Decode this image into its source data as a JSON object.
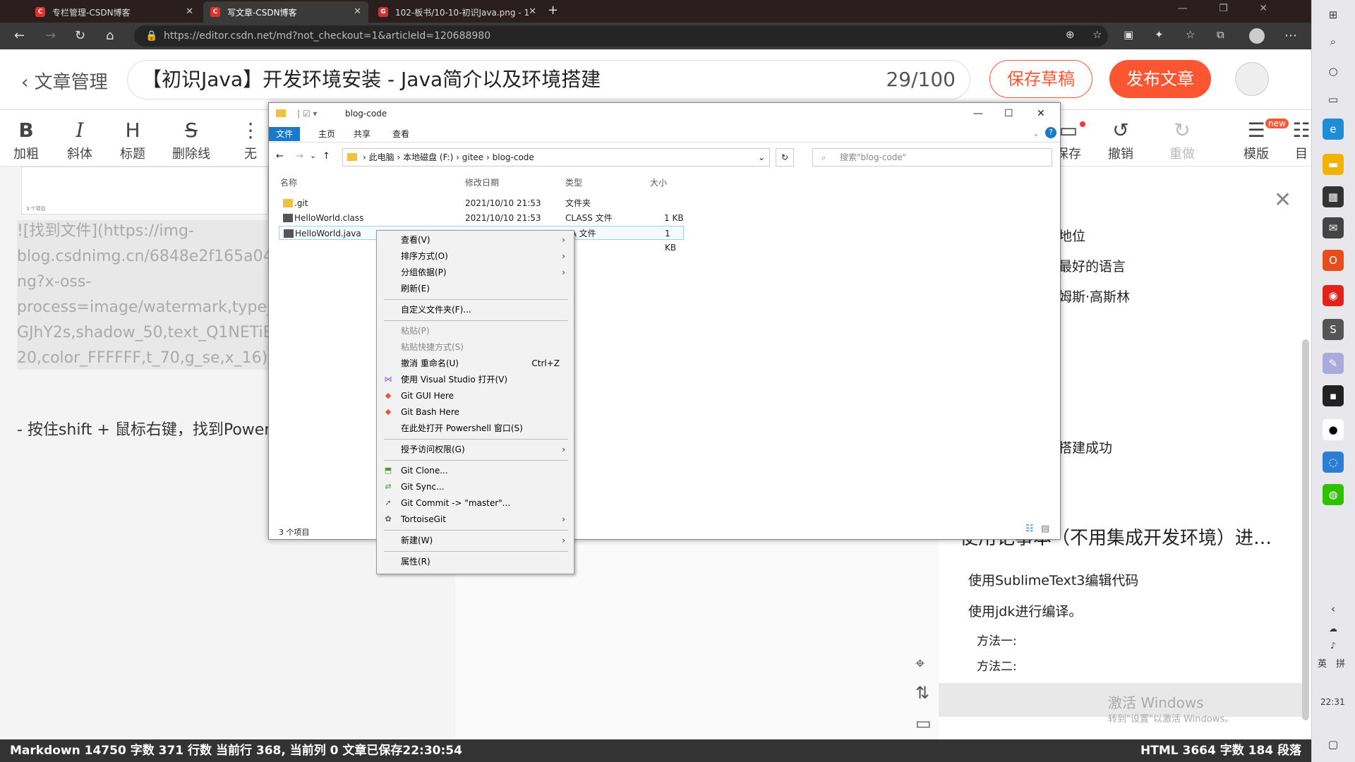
{
  "browser": {
    "tabs": [
      {
        "title": "专栏管理-CSDN博客"
      },
      {
        "title": "写文章-CSDN博客"
      },
      {
        "title": "102-板书/10-10-初识Java.png - 1"
      }
    ],
    "url": "https://editor.csdn.net/md?not_checkout=1&articleId=120688980"
  },
  "header": {
    "back_label": "文章管理",
    "title": "【初识Java】开发环境安装 - Java简介以及环境搭建",
    "title_count": "29/100",
    "save_label": "保存草稿",
    "publish_label": "发布文章"
  },
  "toolbar": {
    "left": [
      {
        "icon": "B",
        "label": "加粗"
      },
      {
        "icon": "I",
        "label": "斜体"
      },
      {
        "icon": "H",
        "label": "标题"
      },
      {
        "icon": "S",
        "label": "删除线"
      }
    ],
    "partial_label": "无",
    "right": [
      {
        "label": "保存"
      },
      {
        "label": "撤销"
      },
      {
        "label": "重做"
      },
      {
        "label": "模版"
      },
      {
        "label": "目"
      }
    ],
    "new_badge": "new"
  },
  "editor": {
    "image_caption": "3 个项目",
    "md_lines": [
      "![找到文件](https://img-",
      "blog.csdnimg.cn/6848e2f165a04d87",
      "ng?x-oss-",
      "process=image/watermark,type_ZH",
      "GJhY2s,shadow_50,text_Q1NETiBA",
      "20,color_FFFFFF,t_70,g_se,x_16)"
    ],
    "bullet_line": "- 按住shift + 鼠标右键，找到Powers"
  },
  "preview": {
    "lines": [
      "地位",
      "最好的语言",
      "姆斯·高斯林",
      "搭建成功"
    ],
    "heading": "使用记事本（不用集成开发环境）进…",
    "para1": "使用SublimeText3编辑代码",
    "para2": "使用jdk进行编译。",
    "method1": "方法一:",
    "method2": "方法二:",
    "watermark1": "激活 Windows",
    "watermark2": "转到\"设置\"以激活 Windows。"
  },
  "statusbar": {
    "left": "Markdown  14750 字数  371 行数  当前行 368, 当前列 0  文章已保存22:30:54",
    "right": "HTML  3664 字数  184 段落"
  },
  "explorer": {
    "title": "blog-code",
    "ribbon_tabs": [
      "文件",
      "主页",
      "共享",
      "查看"
    ],
    "path": [
      "此电脑",
      "本地磁盘 (F:)",
      "gitee",
      "blog-code"
    ],
    "search_placeholder": "搜索\"blog-code\"",
    "columns": [
      "名称",
      "修改日期",
      "类型",
      "大小"
    ],
    "files": [
      {
        "name": ".git",
        "date": "2021/10/10 21:53",
        "type": "文件夹",
        "size": ""
      },
      {
        "name": "HelloWorld.class",
        "date": "2021/10/10 21:53",
        "type": "CLASS 文件",
        "size": "1 KB"
      },
      {
        "name": "HelloWorld.java",
        "date": "",
        "type": "VA 文件",
        "size": "1 KB"
      }
    ],
    "status": "3 个项目"
  },
  "context_menu": [
    {
      "label": "查看(V)",
      "arrow": true
    },
    {
      "label": "排序方式(O)",
      "arrow": true
    },
    {
      "label": "分组依据(P)",
      "arrow": true
    },
    {
      "label": "刷新(E)"
    },
    {
      "sep": true
    },
    {
      "label": "自定义文件夹(F)..."
    },
    {
      "sep": true
    },
    {
      "label": "粘贴(P)",
      "disabled": true
    },
    {
      "label": "粘贴快捷方式(S)",
      "disabled": true
    },
    {
      "label": "撤消 重命名(U)",
      "shortcut": "Ctrl+Z"
    },
    {
      "label": "使用 Visual Studio 打开(V)",
      "icon": "vs"
    },
    {
      "label": "Git GUI Here",
      "icon": "git"
    },
    {
      "label": "Git Bash Here",
      "icon": "git"
    },
    {
      "label": "在此处打开 Powershell 窗口(S)"
    },
    {
      "sep": true
    },
    {
      "label": "授予访问权限(G)",
      "arrow": true
    },
    {
      "sep": true
    },
    {
      "label": "Git Clone...",
      "icon": "tgit"
    },
    {
      "label": "Git Sync...",
      "icon": "tgit"
    },
    {
      "label": "Git Commit -> \"master\"...",
      "icon": "tgit"
    },
    {
      "label": "TortoiseGit",
      "arrow": true,
      "icon": "tgit"
    },
    {
      "sep": true
    },
    {
      "label": "新建(W)",
      "arrow": true
    },
    {
      "sep": true
    },
    {
      "label": "属性(R)"
    }
  ],
  "system": {
    "time": "22:31",
    "ime1": "英",
    "ime2": "拼"
  },
  "colors": {
    "accent": "#fc5531",
    "explorer_tab": "#1979ca"
  }
}
